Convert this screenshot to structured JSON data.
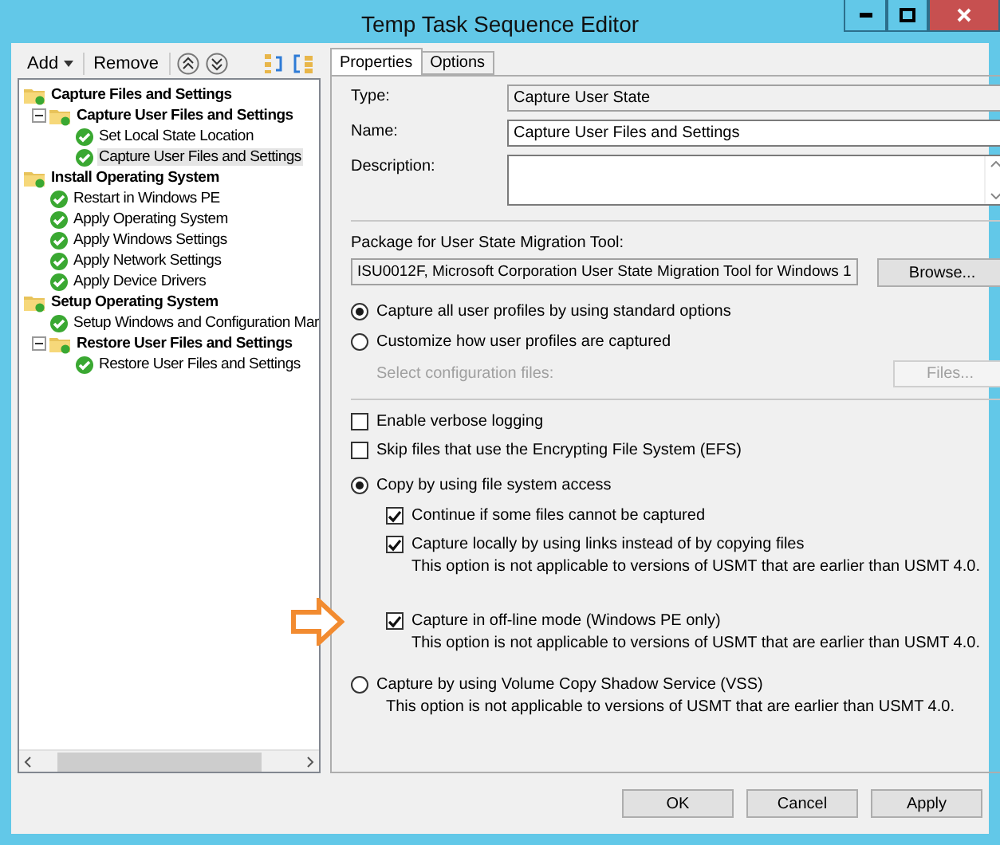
{
  "window": {
    "title": "Temp Task Sequence Editor"
  },
  "toolbar": {
    "add": "Add",
    "remove": "Remove"
  },
  "tree": [
    {
      "label": "Capture Files and Settings",
      "kind": "group",
      "expanded": true,
      "selected": false,
      "children": [
        {
          "label": "Capture User Files and Settings",
          "kind": "group",
          "expanded": true,
          "selected": false,
          "children": [
            {
              "label": "Set Local State Location",
              "kind": "step",
              "selected": false
            },
            {
              "label": "Capture User Files and Settings",
              "kind": "step",
              "selected": true
            }
          ]
        }
      ]
    },
    {
      "label": "Install Operating System",
      "kind": "group",
      "expanded": true,
      "selected": false,
      "children": [
        {
          "label": "Restart in Windows PE",
          "kind": "step",
          "selected": false
        },
        {
          "label": "Apply Operating System",
          "kind": "step",
          "selected": false
        },
        {
          "label": "Apply Windows Settings",
          "kind": "step",
          "selected": false
        },
        {
          "label": "Apply Network Settings",
          "kind": "step",
          "selected": false
        },
        {
          "label": "Apply Device Drivers",
          "kind": "step",
          "selected": false
        }
      ]
    },
    {
      "label": "Setup Operating System",
      "kind": "group",
      "expanded": true,
      "selected": false,
      "children": [
        {
          "label": "Setup Windows and Configuration Mar",
          "kind": "step",
          "selected": false
        },
        {
          "label": "Restore User Files and Settings",
          "kind": "group",
          "expanded": true,
          "selected": false,
          "children": [
            {
              "label": "Restore User Files and Settings",
              "kind": "step",
              "selected": false
            }
          ]
        }
      ]
    }
  ],
  "tabs": [
    {
      "label": "Properties",
      "selected": true
    },
    {
      "label": "Options",
      "selected": false
    }
  ],
  "fields": [
    {
      "label": "Type:",
      "kind": "readonly",
      "value": "Capture User State"
    },
    {
      "label": "Name:",
      "kind": "text",
      "value": "Capture User Files and Settings"
    },
    {
      "label": "Description:",
      "kind": "multiline"
    }
  ],
  "package": {
    "label": "Package for User State Migration Tool:",
    "value": "ISU0012F, Microsoft Corporation User State Migration Tool for Windows 1",
    "button": "Browse..."
  },
  "profiles": [
    {
      "label": "Capture all user profiles by using standard options",
      "selected": true
    },
    {
      "label": "Customize how user profiles are captured",
      "selected": false
    }
  ],
  "config": {
    "label": "Select configuration files:",
    "button": "Files...",
    "disabled": true
  },
  "options": [
    {
      "label": "Enable verbose logging",
      "checked": false
    },
    {
      "label": "Skip files that use the Encrypting File System (EFS)",
      "checked": false
    }
  ],
  "methods": [
    {
      "label": "Copy by using file system access",
      "selected": true,
      "children": [
        {
          "label": "Continue if some files cannot be captured",
          "checked": true,
          "highlighted": false
        },
        {
          "label": "Capture locally by using links instead of by copying files",
          "checked": true,
          "highlighted": false,
          "note": "This option is not applicable to versions of USMT that are earlier than USMT 4.0."
        },
        {
          "label": "Capture in off-line mode (Windows PE only)",
          "checked": true,
          "highlighted": true,
          "note": "This option is not applicable to versions of USMT that are earlier than USMT 4.0."
        }
      ]
    },
    {
      "label": "Capture by using Volume Copy Shadow Service (VSS)",
      "selected": false,
      "note": "This option is not applicable to versions of USMT that are earlier than USMT 4.0."
    }
  ],
  "buttons": [
    "OK",
    "Cancel",
    "Apply"
  ]
}
